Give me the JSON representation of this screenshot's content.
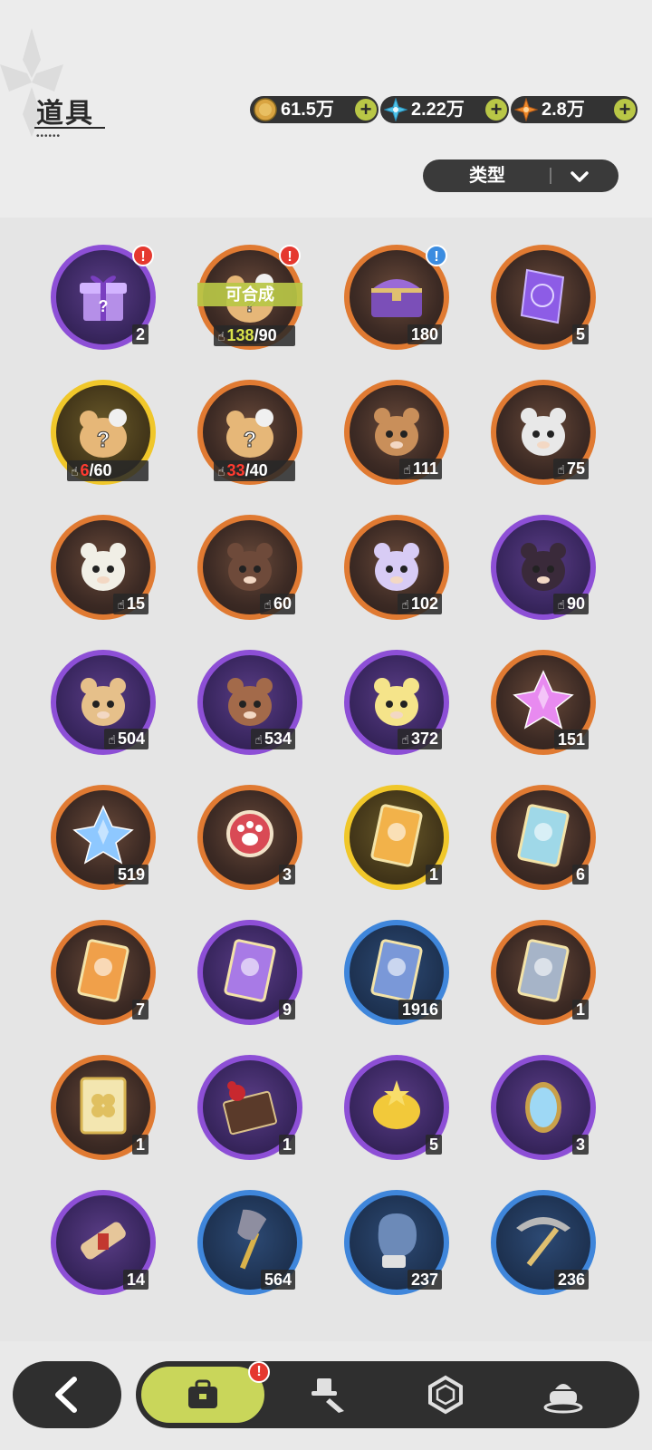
{
  "header": {
    "title": "道具",
    "title_dots": "••••••",
    "currencies": [
      {
        "icon": "gold-coin-icon",
        "value": "61.5万",
        "color": "#d9a441"
      },
      {
        "icon": "crystal-flower-icon",
        "value": "2.22万",
        "color": "#4fc3e8"
      },
      {
        "icon": "orange-star-gem-icon",
        "value": "2.8万",
        "color": "#f08a2a"
      }
    ],
    "add_label": "+",
    "filter_label": "类型"
  },
  "items": [
    {
      "icon": "mystery-gift-box-icon",
      "rarity": "purple",
      "count": "2",
      "badge": "!",
      "badge_color": "red"
    },
    {
      "icon": "mystery-plush-bundle-icon",
      "rarity": "orange",
      "craft_label": "可合成",
      "have": "138",
      "need": "/90",
      "badge": "!",
      "badge_color": "red"
    },
    {
      "icon": "treasure-chest-icon",
      "rarity": "orange",
      "count": "180",
      "badge": "!",
      "badge_color": "blue"
    },
    {
      "icon": "purple-crystal-card-icon",
      "rarity": "orange",
      "count": "5"
    },
    {
      "icon": "mystery-plush-gold-icon",
      "rarity": "gold",
      "have": "6",
      "need": "/60",
      "low": true
    },
    {
      "icon": "mystery-plush-orange-icon",
      "rarity": "orange",
      "have": "33",
      "need": "/40",
      "low": true
    },
    {
      "icon": "bear-plush-icon",
      "rarity": "orange",
      "count": "111",
      "shard": true
    },
    {
      "icon": "knight-plush-icon",
      "rarity": "orange",
      "count": "75",
      "shard": true
    },
    {
      "icon": "white-cat-plush-icon",
      "rarity": "orange",
      "count": "15",
      "shard": true
    },
    {
      "icon": "brown-bear-plush-icon",
      "rarity": "orange",
      "count": "60",
      "shard": true
    },
    {
      "icon": "lilac-goat-plush-icon",
      "rarity": "orange",
      "count": "102",
      "shard": true
    },
    {
      "icon": "black-bear-plush-icon",
      "rarity": "purple",
      "count": "90",
      "shard": true
    },
    {
      "icon": "green-sprout-plush-icon",
      "rarity": "purple",
      "count": "504",
      "shard": true
    },
    {
      "icon": "brown-eyepatch-plush-icon",
      "rarity": "purple",
      "count": "534",
      "shard": true
    },
    {
      "icon": "yellow-chick-plush-icon",
      "rarity": "purple",
      "count": "372",
      "shard": true
    },
    {
      "icon": "pink-star-crystal-icon",
      "rarity": "orange",
      "count": "151"
    },
    {
      "icon": "blue-star-crystal-icon",
      "rarity": "orange",
      "count": "519"
    },
    {
      "icon": "paw-medallion-icon",
      "rarity": "orange",
      "count": "3"
    },
    {
      "icon": "golden-character-card-icon",
      "rarity": "gold",
      "count": "1"
    },
    {
      "icon": "holo-character-card-icon",
      "rarity": "orange",
      "count": "6"
    },
    {
      "icon": "orange-character-card-icon",
      "rarity": "orange",
      "count": "7"
    },
    {
      "icon": "purple-character-card-icon",
      "rarity": "purple",
      "count": "9"
    },
    {
      "icon": "blue-character-card-icon",
      "rarity": "blue",
      "count": "1916"
    },
    {
      "icon": "silver-character-card-icon",
      "rarity": "orange",
      "count": "1"
    },
    {
      "icon": "clover-card-icon",
      "rarity": "orange",
      "count": "1"
    },
    {
      "icon": "rose-gift-box-icon",
      "rarity": "purple",
      "count": "1"
    },
    {
      "icon": "golden-bag-icon",
      "rarity": "purple",
      "count": "5"
    },
    {
      "icon": "magic-mirror-icon",
      "rarity": "purple",
      "count": "3"
    },
    {
      "icon": "scroll-icon",
      "rarity": "purple",
      "count": "14"
    },
    {
      "icon": "shovel-icon",
      "rarity": "blue",
      "count": "564"
    },
    {
      "icon": "boxing-glove-icon",
      "rarity": "blue",
      "count": "237"
    },
    {
      "icon": "pickaxe-icon",
      "rarity": "blue",
      "count": "236"
    }
  ],
  "bottom_nav": {
    "back_icon": "chevron-left-icon",
    "tabs": [
      {
        "icon": "backpack-icon",
        "active": true,
        "badge": "!"
      },
      {
        "icon": "costume-hat-icon",
        "active": false
      },
      {
        "icon": "gem-outline-icon",
        "active": false
      },
      {
        "icon": "cake-icon",
        "active": false
      }
    ]
  },
  "colors": {
    "orange": "#e07a32",
    "purple": "#8d4fd6",
    "gold": "#f0c72a",
    "blue": "#3f86db",
    "accent": "#c9d65a",
    "badge_red": "#e5382f"
  }
}
